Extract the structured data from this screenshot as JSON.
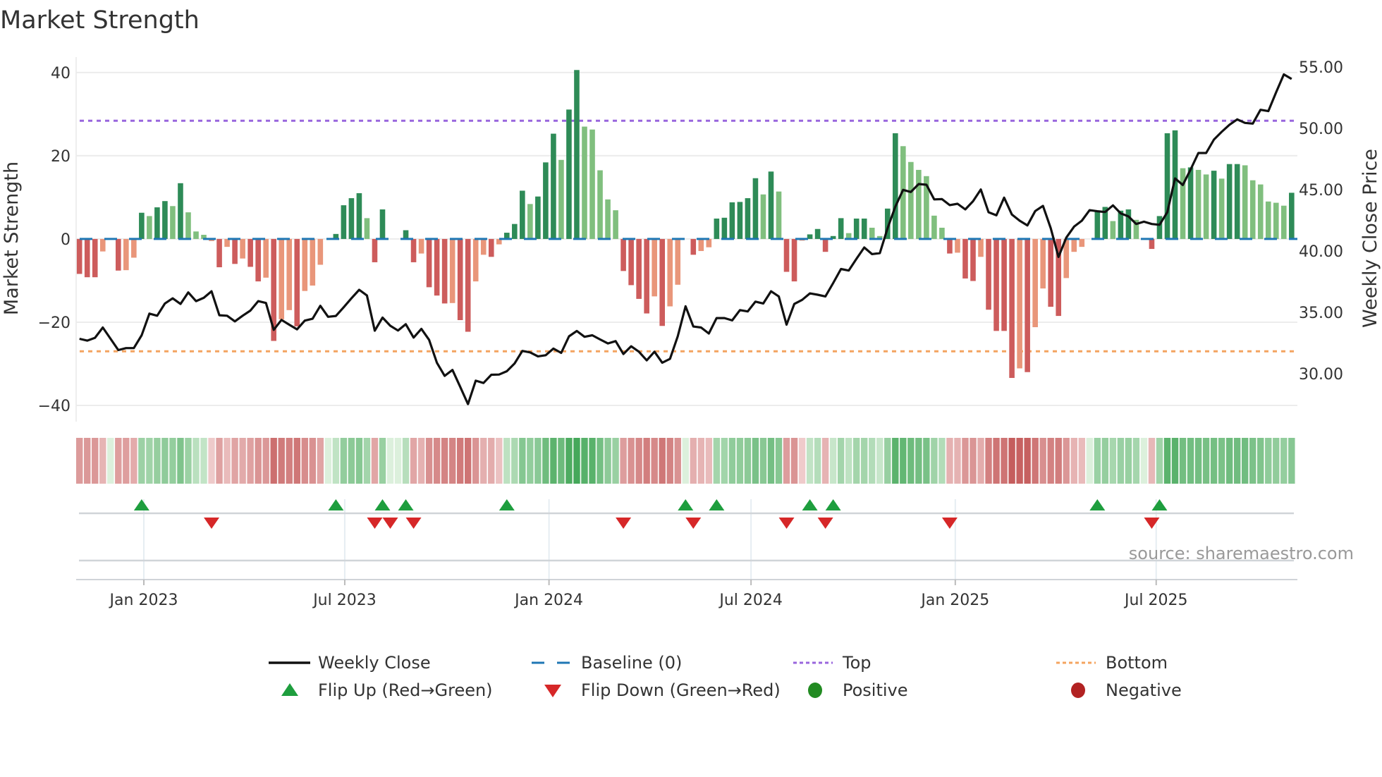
{
  "chart_data": {
    "type": "bar",
    "title": "Market Strength",
    "ylabel": "Market Strength",
    "y2label": "Weekly Close Price",
    "ylim": [
      -43.9,
      43.7
    ],
    "y2lim": [
      26.1,
      55.8
    ],
    "yticks": [
      40,
      20,
      0,
      -20,
      -40
    ],
    "ytick_labels": [
      "40",
      "20",
      "0",
      "−20",
      "−40"
    ],
    "y2ticks": [
      55,
      50,
      45,
      40,
      35,
      30
    ],
    "y2tick_labels": [
      "55.00",
      "50.00",
      "45.00",
      "40.00",
      "35.00",
      "30.00"
    ],
    "x_start_date": "2022-11-04",
    "x_interval_days": 7,
    "xticks": [
      {
        "date": "2023-01-01",
        "label": "Jan 2023"
      },
      {
        "date": "2023-07-01",
        "label": "Jul 2023"
      },
      {
        "date": "2024-01-01",
        "label": "Jan 2024"
      },
      {
        "date": "2024-07-01",
        "label": "Jul 2024"
      },
      {
        "date": "2025-01-01",
        "label": "Jan 2025"
      },
      {
        "date": "2025-07-01",
        "label": "Jul 2025"
      }
    ],
    "grid": true,
    "top_level": 28.4,
    "bottom_level": -27.0,
    "baseline": 0,
    "strength": [
      -8.4,
      -9.2,
      -9.2,
      -3.0,
      0,
      -7.6,
      -7.5,
      -4.5,
      6.3,
      5.5,
      7.6,
      9.1,
      7.9,
      13.4,
      6.4,
      1.8,
      1.0,
      -0.5,
      -6.8,
      -1.9,
      -6.0,
      -4.7,
      -6.7,
      -10.2,
      -9.3,
      -24.5,
      -19.3,
      -17.1,
      -21.0,
      -12.5,
      -11.2,
      -6.2,
      0,
      1.2,
      8.1,
      9.8,
      11.0,
      5.0,
      -5.6,
      7.1,
      0,
      0,
      2.1,
      -5.6,
      -3.5,
      -11.6,
      -13.6,
      -15.5,
      -15.4,
      -19.5,
      -22.3,
      -10.2,
      -3.8,
      -4.3,
      -1.3,
      1.5,
      3.6,
      11.6,
      8.4,
      10.2,
      18.4,
      25.3,
      19.0,
      31.1,
      40.6,
      27.0,
      26.3,
      16.5,
      9.5,
      6.9,
      -7.7,
      -11.1,
      -14.4,
      -17.9,
      -13.8,
      -20.9,
      -16.2,
      -11.0,
      0,
      -3.8,
      -2.9,
      -2.0,
      4.9,
      5.1,
      8.8,
      8.9,
      9.8,
      14.6,
      10.7,
      16.2,
      11.4,
      -7.9,
      -10.2,
      -0.4,
      1.1,
      2.4,
      -3.1,
      0.7,
      5.0,
      1.4,
      4.9,
      4.9,
      2.7,
      0.7,
      7.3,
      25.4,
      22.3,
      18.5,
      16.6,
      15.1,
      5.6,
      2.7,
      -3.5,
      -3.3,
      -9.5,
      -10.1,
      -4.3,
      -17.0,
      -22.1,
      -22.1,
      -33.4,
      -31.1,
      -32.0,
      -21.2,
      -11.9,
      -16.3,
      -18.5,
      -9.4,
      -3.1,
      -1.9,
      0,
      6.6,
      7.7,
      4.3,
      6.8,
      7.1,
      4.6,
      0,
      -2.4,
      5.5,
      25.4,
      26.1,
      17.0,
      17.2,
      16.6,
      15.5,
      16.4,
      14.5,
      18.0,
      18.0,
      17.7,
      14.1,
      13.1,
      9.0,
      8.7,
      8.0,
      11.1
    ],
    "strong": [
      1,
      1,
      1,
      0,
      0,
      1,
      0,
      0,
      1,
      0,
      1,
      1,
      0,
      1,
      0,
      0,
      0,
      0,
      1,
      0,
      1,
      0,
      1,
      1,
      0,
      1,
      0,
      0,
      1,
      0,
      0,
      0,
      0,
      1,
      1,
      1,
      1,
      0,
      1,
      1,
      0,
      0,
      1,
      1,
      0,
      1,
      1,
      1,
      0,
      1,
      1,
      0,
      0,
      1,
      0,
      1,
      1,
      1,
      0,
      1,
      1,
      1,
      0,
      1,
      1,
      0,
      0,
      0,
      0,
      0,
      1,
      1,
      1,
      1,
      0,
      1,
      0,
      0,
      0,
      1,
      0,
      0,
      1,
      1,
      1,
      1,
      1,
      1,
      0,
      1,
      0,
      1,
      1,
      0,
      1,
      1,
      1,
      1,
      1,
      0,
      1,
      1,
      0,
      0,
      1,
      1,
      0,
      0,
      0,
      0,
      0,
      0,
      1,
      0,
      1,
      1,
      0,
      1,
      1,
      1,
      1,
      0,
      1,
      0,
      0,
      1,
      1,
      0,
      0,
      0,
      0,
      1,
      1,
      0,
      1,
      1,
      0,
      0,
      1,
      1,
      1,
      1,
      0,
      1,
      0,
      0,
      1,
      0,
      1,
      1,
      0,
      0,
      0,
      0,
      0,
      0,
      1
    ],
    "close": [
      32.85,
      32.7,
      32.93,
      33.77,
      32.85,
      31.93,
      32.09,
      32.09,
      33.14,
      34.9,
      34.73,
      35.73,
      36.15,
      35.69,
      36.63,
      35.92,
      36.19,
      36.72,
      34.77,
      34.73,
      34.27,
      34.73,
      35.15,
      35.92,
      35.77,
      33.58,
      34.39,
      34.0,
      33.62,
      34.33,
      34.48,
      35.54,
      34.64,
      34.71,
      35.42,
      36.15,
      36.84,
      36.38,
      33.51,
      34.58,
      33.91,
      33.52,
      34.04,
      32.95,
      33.66,
      32.76,
      30.9,
      29.83,
      30.31,
      28.93,
      27.53,
      29.44,
      29.25,
      29.92,
      29.94,
      30.21,
      30.84,
      31.86,
      31.74,
      31.42,
      31.51,
      32.05,
      31.7,
      33.05,
      33.49,
      33.01,
      33.14,
      32.8,
      32.47,
      32.66,
      31.61,
      32.24,
      31.8,
      31.09,
      31.8,
      30.9,
      31.21,
      33.05,
      35.5,
      33.85,
      33.77,
      33.28,
      34.54,
      34.54,
      34.35,
      35.19,
      35.08,
      35.88,
      35.73,
      36.72,
      36.3,
      34.0,
      35.69,
      36.02,
      36.55,
      36.44,
      36.3,
      37.39,
      38.54,
      38.41,
      39.37,
      40.29,
      39.75,
      39.83,
      41.86,
      43.62,
      44.98,
      44.81,
      45.46,
      45.4,
      44.21,
      44.23,
      43.74,
      43.85,
      43.39,
      44.06,
      45.02,
      43.16,
      42.91,
      44.35,
      42.97,
      42.47,
      42.09,
      43.26,
      43.68,
      41.86,
      39.52,
      41.09,
      41.99,
      42.47,
      43.33,
      43.24,
      43.18,
      43.72,
      43.07,
      42.82,
      42.2,
      42.39,
      42.2,
      42.14,
      43.16,
      45.92,
      45.38,
      46.65,
      47.99,
      47.99,
      49.08,
      49.71,
      50.29,
      50.73,
      50.44,
      50.38,
      51.51,
      51.4,
      52.93,
      54.39,
      54.02
    ],
    "flip_up_weeks": [
      9,
      34,
      40,
      43,
      56,
      79,
      83,
      95,
      98,
      132,
      140
    ],
    "flip_down_weeks": [
      18,
      39,
      41,
      44,
      71,
      80,
      92,
      97,
      113,
      139
    ],
    "legend_position": "bottom",
    "legend": [
      {
        "key": "close",
        "label": "Weekly Close"
      },
      {
        "key": "baseline",
        "label": "Baseline (0)"
      },
      {
        "key": "top",
        "label": "Top"
      },
      {
        "key": "bottom",
        "label": "Bottom"
      },
      {
        "key": "flip_up",
        "label": "Flip Up (Red→Green)"
      },
      {
        "key": "flip_down",
        "label": "Flip Down (Green→Red)"
      },
      {
        "key": "positive",
        "label": "Positive"
      },
      {
        "key": "negative",
        "label": "Negative"
      }
    ],
    "source": "source: sharemaestro.com"
  },
  "colors": {
    "pos_strong": "#2e8b57",
    "pos_weak": "#80bf7e",
    "neg_strong": "#cd5c5c",
    "neg_weak": "#e9967a",
    "baseline": "#1f77b4",
    "top": "#9966dd",
    "bottom": "#f4a460",
    "close": "#111111",
    "flip_up": "#1e9e3e",
    "flip_down": "#d62728",
    "positive": "#228b22",
    "negative": "#b22222"
  }
}
